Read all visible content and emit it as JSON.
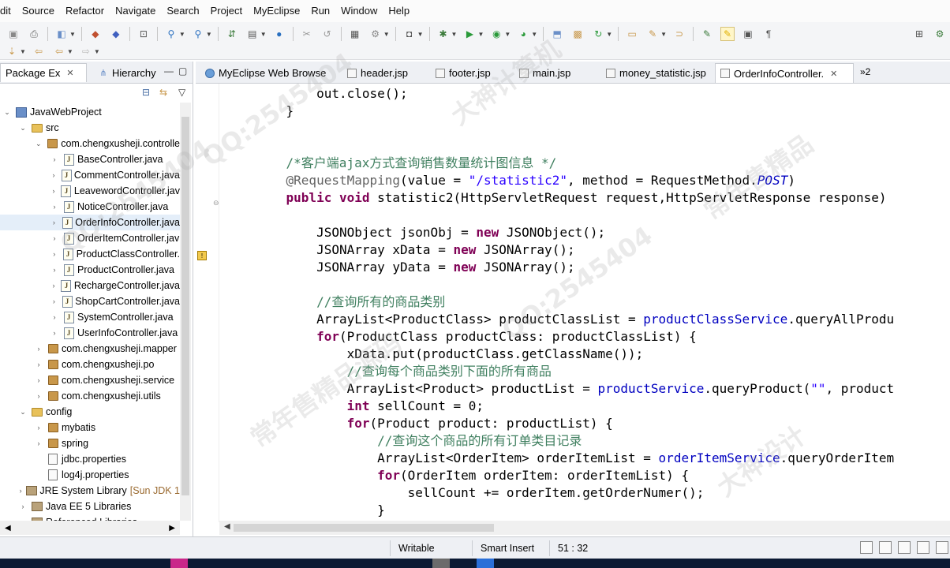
{
  "menubar": {
    "items": [
      "dit",
      "Source",
      "Refactor",
      "Navigate",
      "Search",
      "Project",
      "MyEclipse",
      "Run",
      "Window",
      "Help"
    ]
  },
  "left_panel": {
    "tabs": [
      {
        "label": "Package Ex",
        "close": "✕",
        "icon": "package-explorer-icon"
      },
      {
        "label": "Hierarchy",
        "icon": "hierarchy-icon"
      }
    ],
    "tree": [
      {
        "label": "JavaWebProject",
        "level": 0,
        "twisty": "open",
        "icon": "project"
      },
      {
        "label": "src",
        "level": 1,
        "twisty": "open",
        "icon": "folder"
      },
      {
        "label": "com.chengxusheji.controlle",
        "level": 2,
        "twisty": "open",
        "icon": "package"
      },
      {
        "label": "BaseController.java",
        "level": 3,
        "twisty": "closed",
        "icon": "java"
      },
      {
        "label": "CommentController.java",
        "level": 3,
        "twisty": "closed",
        "icon": "java"
      },
      {
        "label": "LeavewordController.jav",
        "level": 3,
        "twisty": "closed",
        "icon": "java"
      },
      {
        "label": "NoticeController.java",
        "level": 3,
        "twisty": "closed",
        "icon": "java"
      },
      {
        "label": "OrderInfoController.java",
        "level": 3,
        "twisty": "closed",
        "icon": "java",
        "selected": true
      },
      {
        "label": "OrderItemController.jav",
        "level": 3,
        "twisty": "closed",
        "icon": "java"
      },
      {
        "label": "ProductClassController.",
        "level": 3,
        "twisty": "closed",
        "icon": "java"
      },
      {
        "label": "ProductController.java",
        "level": 3,
        "twisty": "closed",
        "icon": "java"
      },
      {
        "label": "RechargeController.java",
        "level": 3,
        "twisty": "closed",
        "icon": "java"
      },
      {
        "label": "ShopCartController.java",
        "level": 3,
        "twisty": "closed",
        "icon": "java"
      },
      {
        "label": "SystemController.java",
        "level": 3,
        "twisty": "closed",
        "icon": "java"
      },
      {
        "label": "UserInfoController.java",
        "level": 3,
        "twisty": "closed",
        "icon": "java"
      },
      {
        "label": "com.chengxusheji.mapper",
        "level": 2,
        "twisty": "closed",
        "icon": "package"
      },
      {
        "label": "com.chengxusheji.po",
        "level": 2,
        "twisty": "closed",
        "icon": "package"
      },
      {
        "label": "com.chengxusheji.service",
        "level": 2,
        "twisty": "closed",
        "icon": "package"
      },
      {
        "label": "com.chengxusheji.utils",
        "level": 2,
        "twisty": "closed",
        "icon": "package"
      },
      {
        "label": "config",
        "level": 1,
        "twisty": "open",
        "icon": "folder"
      },
      {
        "label": "mybatis",
        "level": 2,
        "twisty": "closed",
        "icon": "package"
      },
      {
        "label": "spring",
        "level": 2,
        "twisty": "closed",
        "icon": "package"
      },
      {
        "label": "jdbc.properties",
        "level": 2,
        "twisty": "none",
        "icon": "file"
      },
      {
        "label": "log4j.properties",
        "level": 2,
        "twisty": "none",
        "icon": "file"
      },
      {
        "label": "JRE System Library",
        "suffix": "[Sun JDK 1",
        "level": 1,
        "twisty": "closed",
        "icon": "library"
      },
      {
        "label": "Java EE 5 Libraries",
        "level": 1,
        "twisty": "closed",
        "icon": "library"
      },
      {
        "label": "Referenced Libraries",
        "level": 1,
        "twisty": "closed",
        "icon": "library"
      }
    ]
  },
  "editor": {
    "tabs": [
      {
        "label": "MyEclipse Web Browse",
        "icon": "globe",
        "active": false
      },
      {
        "label": "header.jsp",
        "icon": "jsp",
        "active": false
      },
      {
        "label": "footer.jsp",
        "icon": "jsp",
        "active": false
      },
      {
        "label": "main.jsp",
        "icon": "jsp",
        "active": false
      },
      {
        "label": "money_statistic.jsp",
        "icon": "jsp",
        "active": false
      },
      {
        "label": "OrderInfoController.",
        "icon": "java",
        "active": true,
        "close": "✕"
      }
    ],
    "overflow_label": "»2",
    "code_lines": [
      [
        {
          "t": "        out.close();",
          "c": ""
        }
      ],
      [
        {
          "t": "    }",
          "c": ""
        }
      ],
      [
        {
          "t": "",
          "c": ""
        }
      ],
      [
        {
          "t": "",
          "c": ""
        }
      ],
      [
        {
          "t": "    /*客户端ajax方式查询销售数量统计图信息 */",
          "c": "cm"
        }
      ],
      [
        {
          "t": "    @RequestMapping",
          "c": "ann"
        },
        {
          "t": "(value = ",
          "c": ""
        },
        {
          "t": "\"/statistic2\"",
          "c": "str"
        },
        {
          "t": ", method = RequestMethod.",
          "c": ""
        },
        {
          "t": "POST",
          "c": "fld it"
        },
        {
          "t": ")",
          "c": ""
        }
      ],
      [
        {
          "t": "    ",
          "c": ""
        },
        {
          "t": "public void",
          "c": "kw"
        },
        {
          "t": " statistic2(HttpServletRequest request,HttpServletResponse response)",
          "c": ""
        }
      ],
      [
        {
          "t": "",
          "c": ""
        }
      ],
      [
        {
          "t": "        JSONObject jsonObj = ",
          "c": ""
        },
        {
          "t": "new",
          "c": "kw"
        },
        {
          "t": " JSONObject();",
          "c": ""
        }
      ],
      [
        {
          "t": "        JSONArray xData = ",
          "c": ""
        },
        {
          "t": "new",
          "c": "kw"
        },
        {
          "t": " JSONArray();",
          "c": ""
        }
      ],
      [
        {
          "t": "        JSONArray yData = ",
          "c": ""
        },
        {
          "t": "new",
          "c": "kw"
        },
        {
          "t": " JSONArray();",
          "c": ""
        }
      ],
      [
        {
          "t": "",
          "c": ""
        }
      ],
      [
        {
          "t": "        //查询所有的商品类别",
          "c": "cm"
        }
      ],
      [
        {
          "t": "        ArrayList<ProductClass> productClassList = ",
          "c": ""
        },
        {
          "t": "productClassService",
          "c": "fld"
        },
        {
          "t": ".queryAllProdu",
          "c": ""
        }
      ],
      [
        {
          "t": "        ",
          "c": ""
        },
        {
          "t": "for",
          "c": "kw"
        },
        {
          "t": "(ProductClass productClass: productClassList) {",
          "c": ""
        }
      ],
      [
        {
          "t": "            xData.put(productClass.getClassName());",
          "c": ""
        }
      ],
      [
        {
          "t": "            //查询每个商品类别下面的所有商品",
          "c": "cm"
        }
      ],
      [
        {
          "t": "            ArrayList<Product> productList = ",
          "c": ""
        },
        {
          "t": "productService",
          "c": "fld"
        },
        {
          "t": ".queryProduct(",
          "c": ""
        },
        {
          "t": "\"\"",
          "c": "str"
        },
        {
          "t": ", product",
          "c": ""
        }
      ],
      [
        {
          "t": "            ",
          "c": ""
        },
        {
          "t": "int",
          "c": "kw"
        },
        {
          "t": " sellCount = 0;",
          "c": ""
        }
      ],
      [
        {
          "t": "            ",
          "c": ""
        },
        {
          "t": "for",
          "c": "kw"
        },
        {
          "t": "(Product product: productList) {",
          "c": ""
        }
      ],
      [
        {
          "t": "                //查询这个商品的所有订单类目记录",
          "c": "cm"
        }
      ],
      [
        {
          "t": "                ArrayList<OrderItem> orderItemList = ",
          "c": ""
        },
        {
          "t": "orderItemService",
          "c": "fld"
        },
        {
          "t": ".queryOrderItem",
          "c": ""
        }
      ],
      [
        {
          "t": "                ",
          "c": ""
        },
        {
          "t": "for",
          "c": "kw"
        },
        {
          "t": "(OrderItem orderItem: orderItemList) {",
          "c": ""
        }
      ],
      [
        {
          "t": "                    sellCount += orderItem.getOrderNumer();",
          "c": ""
        }
      ],
      [
        {
          "t": "                }",
          "c": ""
        }
      ]
    ]
  },
  "statusbar": {
    "mode": "Writable",
    "insert_mode": "Smart Insert",
    "position": "51 : 32"
  },
  "watermarks": [
    "QQ:2545404",
    "QQ:2545404",
    "常年售精品源码",
    "大神计算机",
    "QQ:2545404",
    "常年售精品",
    "大神设计"
  ],
  "colors": {
    "keyword": "#7f0055",
    "string": "#2a00ff",
    "comment": "#3f7f5f",
    "field": "#0000c0",
    "annotation": "#646464"
  }
}
